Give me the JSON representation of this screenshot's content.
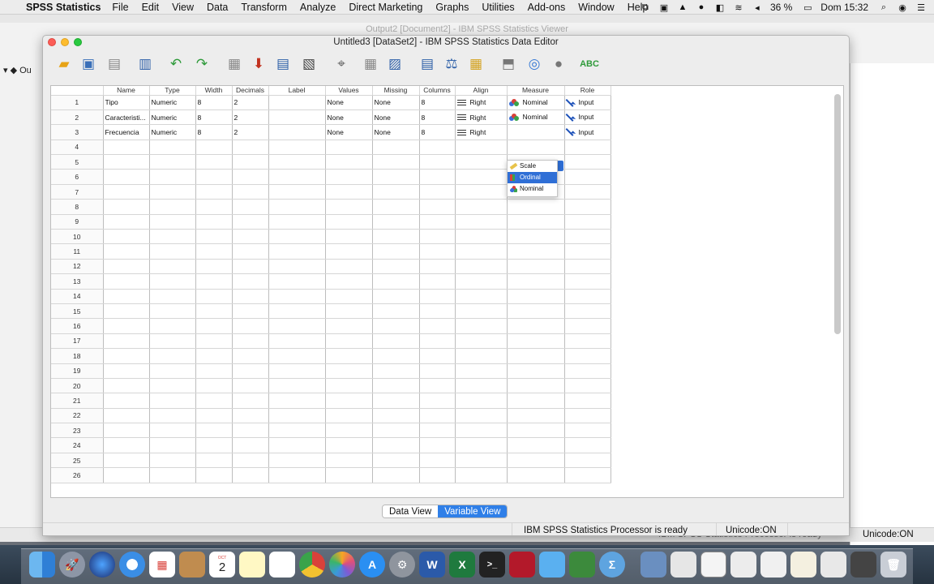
{
  "menubar": {
    "app_name": "SPSS Statistics",
    "menus": [
      "File",
      "Edit",
      "View",
      "Data",
      "Transform",
      "Analyze",
      "Direct Marketing",
      "Graphs",
      "Utilities",
      "Add-ons",
      "Window",
      "Help"
    ],
    "battery": "36 %",
    "clock": "Dom 15:32"
  },
  "background_windows": {
    "titles": [
      "Output2 [Document2] - IBM SPSS Statistics Viewer"
    ],
    "status": "IBM SPSS Statistics Processor is ready",
    "unicode": "Unicode:ON"
  },
  "editor": {
    "title": "Untitled3 [DataSet2] - IBM SPSS Statistics Data Editor",
    "columns": [
      "Name",
      "Type",
      "Width",
      "Decimals",
      "Label",
      "Values",
      "Missing",
      "Columns",
      "Align",
      "Measure",
      "Role"
    ],
    "variables": [
      {
        "row": "1",
        "name": "Tipo",
        "type": "Numeric",
        "width": "8",
        "decimals": "2",
        "label": "",
        "values": "None",
        "missing": "None",
        "columns": "8",
        "align": "Right",
        "measure": "Nominal",
        "role": "Input"
      },
      {
        "row": "2",
        "name": "Caracteristi...",
        "type": "Numeric",
        "width": "8",
        "decimals": "2",
        "label": "",
        "values": "None",
        "missing": "None",
        "columns": "8",
        "align": "Right",
        "measure": "Nominal",
        "role": "Input"
      },
      {
        "row": "3",
        "name": "Frecuencia",
        "type": "Numeric",
        "width": "8",
        "decimals": "2",
        "label": "",
        "values": "None",
        "missing": "None",
        "columns": "8",
        "align": "Right",
        "measure": "",
        "role": "Input"
      }
    ],
    "empty_rows": [
      "4",
      "5",
      "6",
      "7",
      "8",
      "9",
      "10",
      "11",
      "12",
      "13",
      "14",
      "15",
      "16",
      "17",
      "18",
      "19",
      "20",
      "21",
      "22",
      "23",
      "24",
      "25",
      "26"
    ],
    "measure_options": [
      "Scale",
      "Ordinal",
      "Nominal"
    ],
    "measure_selected": "Ordinal",
    "tabs": [
      "Data View",
      "Variable View"
    ],
    "active_tab": "Variable View",
    "status": "IBM SPSS Statistics Processor is ready",
    "unicode": "Unicode:ON"
  },
  "dock": {
    "calendar_day": "2",
    "calendar_month": "OCT",
    "word_label": "W",
    "excel_label": "X",
    "terminal_label": ">_"
  },
  "colors": {
    "selection_blue": "#2f6fd6",
    "tab_active": "#2f7fe8",
    "scale_icon": "#e8c34a",
    "nominal_red": "#d9413a",
    "nominal_green": "#3aa34a",
    "nominal_blue": "#3a6fd9"
  }
}
